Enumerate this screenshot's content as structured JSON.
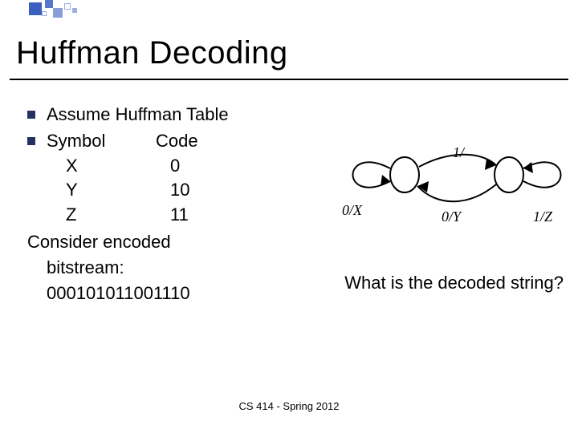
{
  "title": "Huffman Decoding",
  "bullets": {
    "assume": "Assume Huffman Table",
    "table_header": {
      "sym": "Symbol",
      "code": "Code"
    },
    "rows": [
      {
        "sym": "X",
        "code": "0"
      },
      {
        "sym": "Y",
        "code": "10"
      },
      {
        "sym": "Z",
        "code": "11"
      }
    ]
  },
  "consider": {
    "l1": "Consider encoded",
    "l2": "bitstream:",
    "l3": "000101011001110"
  },
  "question": "What is the decoded string?",
  "diagram": {
    "left_label": "0/X",
    "mid_label": "1/",
    "bottom_left": "0/Y",
    "bottom_right": "1/Z"
  },
  "chart_data": {
    "type": "table",
    "title": "Huffman Table",
    "columns": [
      "Symbol",
      "Code"
    ],
    "rows": [
      [
        "X",
        "0"
      ],
      [
        "Y",
        "10"
      ],
      [
        "Z",
        "11"
      ]
    ],
    "bitstream": "000101011001110"
  },
  "footer": "CS 414 - Spring 2012"
}
